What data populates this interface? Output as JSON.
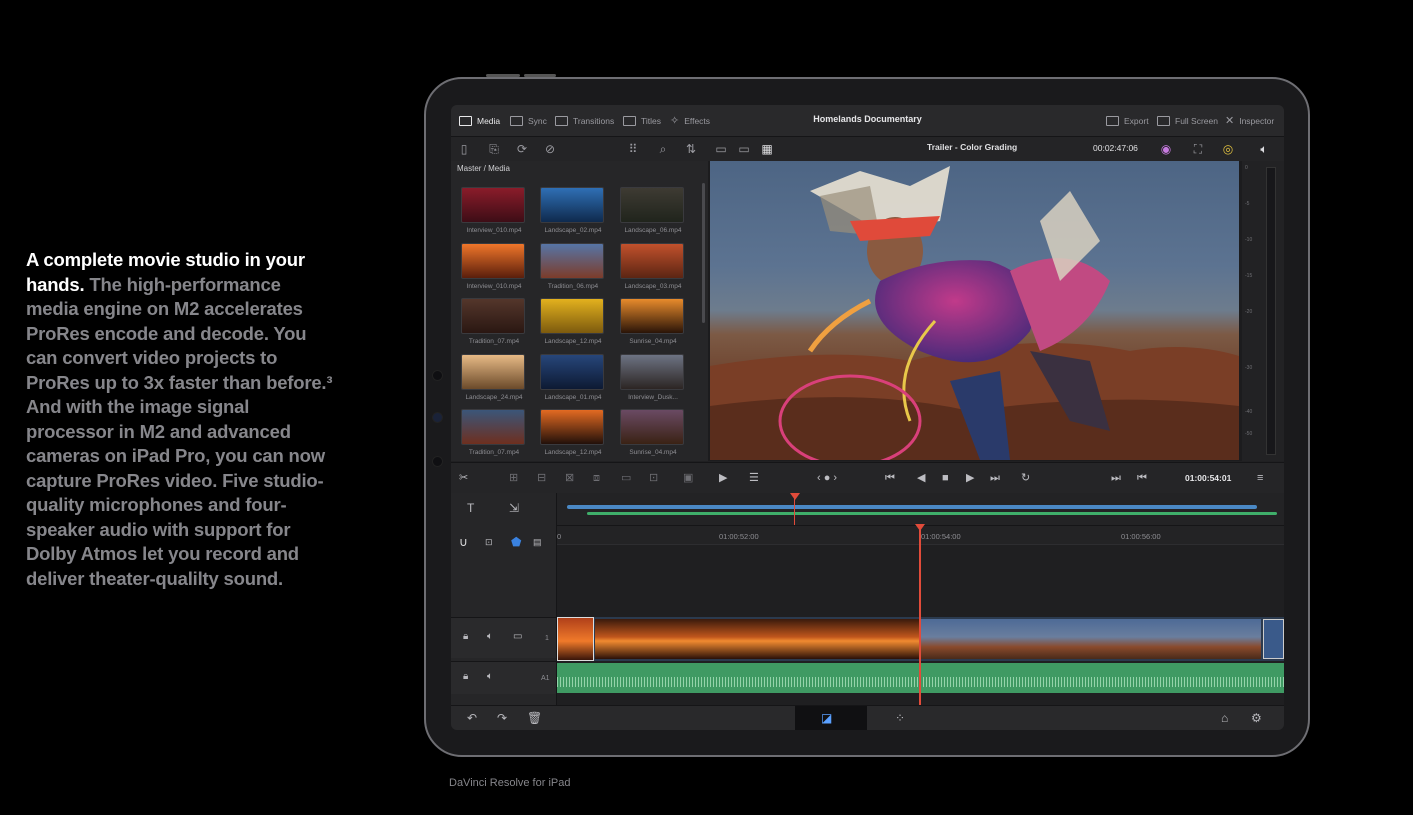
{
  "marketing": {
    "lead": "A complete movie studio in your hands.",
    "body": " The high-performance media engine on M2 accelerates ProRes encode and decode. You can convert video projects to ProRes up to 3x faster than before.³ And with the image signal processor in M2 and advanced cameras on iPad Pro, you can now capture ProRes video. Five studio-quality microphones and four-speaker audio with support for Dolby Atmos let you record and deliver theater-qualilty sound.",
    "caption": "DaVinci Resolve for iPad"
  },
  "app": {
    "tabs": [
      {
        "label": "Media",
        "icon": "image-icon"
      },
      {
        "label": "Sync",
        "icon": "sync-icon"
      },
      {
        "label": "Transitions",
        "icon": "transitions-icon"
      },
      {
        "label": "Titles",
        "icon": "titles-icon"
      },
      {
        "label": "Effects",
        "icon": "effects-icon"
      }
    ],
    "project_title": "Homelands Documentary",
    "right_actions": [
      {
        "label": "Export",
        "icon": "export-icon"
      },
      {
        "label": "Full Screen",
        "icon": "fullscreen-icon"
      },
      {
        "label": "Inspector",
        "icon": "inspector-icon"
      }
    ],
    "timeline_name": "Trailer - Color Grading",
    "timecode_top": "00:02:47:06",
    "breadcrumb": "Master / Media",
    "clips": [
      {
        "name": "Interview_010.mp4",
        "c1": "#8a1c2a",
        "c2": "#3d0d16"
      },
      {
        "name": "Landscape_02.mp4",
        "c1": "#2f6fb5",
        "c2": "#0f2a4d"
      },
      {
        "name": "Landscape_06.mp4",
        "c1": "#3e3b33",
        "c2": "#20241c"
      },
      {
        "name": "Interview_010.mp4",
        "c1": "#f0762a",
        "c2": "#5a1e0c"
      },
      {
        "name": "Tradition_06.mp4",
        "c1": "#5675a6",
        "c2": "#7c3c2a"
      },
      {
        "name": "Landscape_03.mp4",
        "c1": "#c1512c",
        "c2": "#5b2513"
      },
      {
        "name": "Tradition_07.mp4",
        "c1": "#54362b",
        "c2": "#2a1712"
      },
      {
        "name": "Landscape_12.mp4",
        "c1": "#e3b11e",
        "c2": "#7c5a0e"
      },
      {
        "name": "Sunrise_04.mp4",
        "c1": "#e88b2c",
        "c2": "#2a1408"
      },
      {
        "name": "Landscape_24.mp4",
        "c1": "#e7ba86",
        "c2": "#6b4a2a"
      },
      {
        "name": "Landscape_01.mp4",
        "c1": "#27467a",
        "c2": "#0d1a33"
      },
      {
        "name": "Interview_Dusk...",
        "c1": "#6d7383",
        "c2": "#2c2523"
      },
      {
        "name": "Tradition_07.mp4",
        "c1": "#3b5679",
        "c2": "#6e2f1f"
      },
      {
        "name": "Landscape_12.mp4",
        "c1": "#e36a22",
        "c2": "#22100a"
      },
      {
        "name": "Sunrise_04.mp4",
        "c1": "#6a4a63",
        "c2": "#3a2214"
      }
    ],
    "meter_labels": [
      "0",
      "-5",
      "-10",
      "-15",
      "-20",
      "-30",
      "-40",
      "-50"
    ],
    "timecode_main": "01:00:54:01",
    "ruler_labels": [
      "0",
      "01:00:52:00",
      "01:00:54:00",
      "01:00:56:00"
    ],
    "video_track_num": "1",
    "audio_track_num": "A1",
    "colors": {
      "accent_red": "#e14b3a",
      "video_track": "#2b3a4e",
      "audio_track": "#3f9a63",
      "mini_blue": "#4a88c4",
      "mini_green": "#3fae6a"
    }
  }
}
